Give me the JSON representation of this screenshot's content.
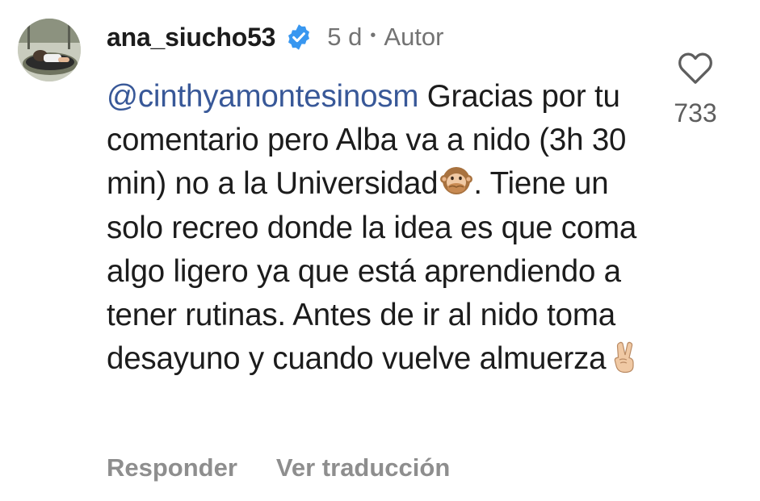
{
  "comment": {
    "username": "ana_siucho53",
    "verified": true,
    "time_ago": "5 d",
    "separator": "•",
    "author_label": "Autor",
    "mention": "@cinthyamontesinosm",
    "text_part1": " Gracias por tu comentario pero Alba va a nido (3h 30 min) no a la Universidad",
    "emoji1": "speak-no-evil-monkey",
    "text_part2": ". Tiene un solo recreo donde la idea es que coma algo ligero ya que está aprendiendo a tener rutinas. Antes de ir al nido toma desayuno y cuando vuelve almuerza",
    "emoji2": "victory-hand",
    "like_count": "733"
  },
  "actions": {
    "reply_label": "Responder",
    "translate_label": "Ver traducción"
  },
  "colors": {
    "mention": "#385898",
    "verified_badge": "#3897f0",
    "muted_text": "#737373"
  }
}
